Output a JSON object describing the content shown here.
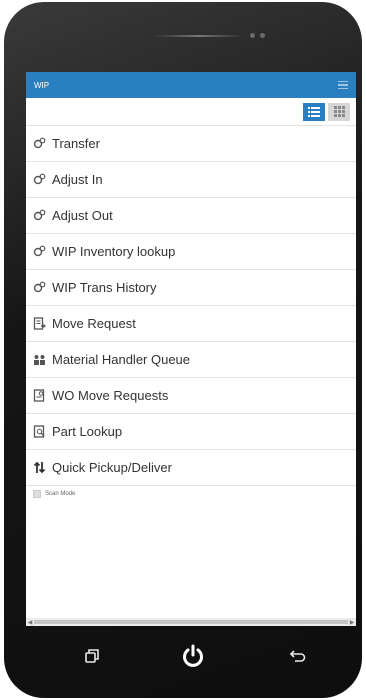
{
  "app": {
    "title": "WIP"
  },
  "menu": [
    {
      "label": "Transfer",
      "icon": "transfer-icon"
    },
    {
      "label": "Adjust In",
      "icon": "adjust-in-icon"
    },
    {
      "label": "Adjust Out",
      "icon": "adjust-out-icon"
    },
    {
      "label": "WIP Inventory lookup",
      "icon": "inventory-lookup-icon"
    },
    {
      "label": "WIP Trans History",
      "icon": "history-icon"
    },
    {
      "label": "Move Request",
      "icon": "move-request-icon"
    },
    {
      "label": "Material Handler Queue",
      "icon": "handler-queue-icon"
    },
    {
      "label": "WO Move Requests",
      "icon": "wo-move-icon"
    },
    {
      "label": "Part Lookup",
      "icon": "part-lookup-icon"
    },
    {
      "label": "Quick Pickup/Deliver",
      "icon": "pickup-deliver-icon"
    }
  ],
  "scan_mode": {
    "label": "Scan Mode"
  },
  "colors": {
    "accent": "#2a7fc0",
    "phone": "#161616"
  }
}
